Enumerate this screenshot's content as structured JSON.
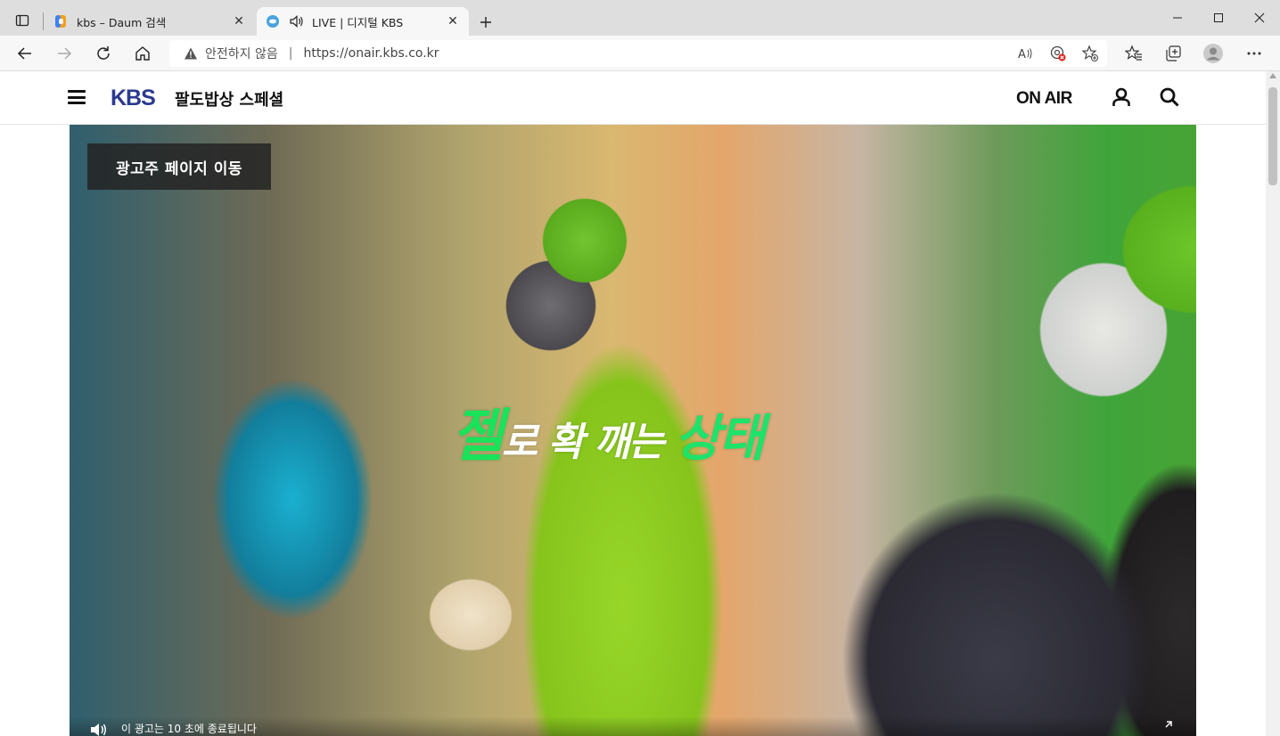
{
  "browser": {
    "tabs": [
      {
        "title": "kbs – Daum 검색",
        "active": false
      },
      {
        "title": "LIVE | 디지털 KBS",
        "active": true
      }
    ],
    "address": {
      "security_label": "안전하지 않음",
      "url": "https://onair.kbs.co.kr"
    },
    "icons": {
      "tab_actions": "tab-actions-icon",
      "new_tab": "plus-icon",
      "back": "back-arrow-icon",
      "forward": "forward-arrow-icon",
      "refresh": "refresh-icon",
      "home": "home-icon",
      "read_aloud": "read-aloud-icon",
      "tracking": "tracking-prevention-icon",
      "add_favorite": "add-favorite-icon",
      "favorites": "favorites-icon",
      "collections": "collections-icon",
      "profile": "profile-icon",
      "more": "more-icon"
    }
  },
  "site": {
    "logo": "KBS",
    "program_title": "팔도밥상 스페셜",
    "on_air_label": "ON AIR"
  },
  "player": {
    "ad_button_label": "광고주 페이지 이동",
    "caption": {
      "part1": "젤",
      "part2": "로 확 깨는 ",
      "part3": "상태"
    },
    "ad_countdown_text": "이 광고는 10 초에 종료됩니다"
  },
  "colors": {
    "brand": "#2b3a8f",
    "caption_green": "#19e35a"
  }
}
